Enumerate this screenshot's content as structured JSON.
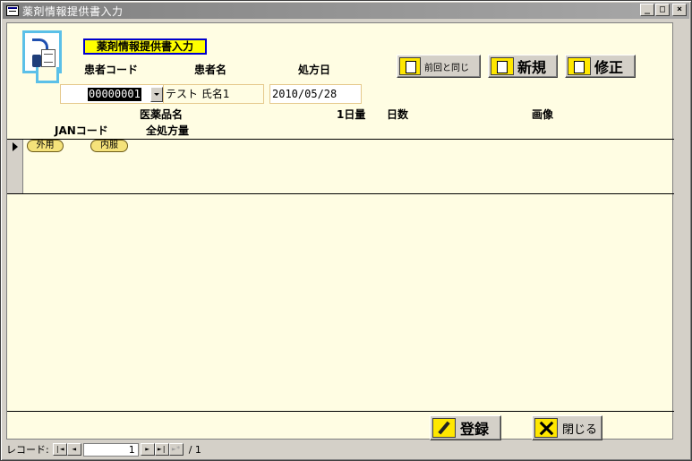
{
  "window": {
    "title": "薬剤情報提供書入力",
    "buttons": {
      "minimize": "_",
      "maximize": "□",
      "close": "×"
    }
  },
  "header": {
    "form_title": "薬剤情報提供書入力",
    "labels": {
      "patient_code": "患者コード",
      "patient_name": "患者名",
      "rx_date": "処方日"
    },
    "fields": {
      "patient_code": "00000001",
      "patient_name": "テスト 氏名1",
      "rx_date": "2010/05/28"
    },
    "buttons": {
      "prev_same": "前回と同じ",
      "new": "新規",
      "edit": "修正"
    }
  },
  "columns": {
    "drug_name": "医薬品名",
    "daily_dose": "1日量",
    "days": "日数",
    "image": "画像",
    "jan_code": "JANコード",
    "total_dose": "全処方量"
  },
  "detail": {
    "pills": [
      "外用",
      "内服"
    ]
  },
  "footer": {
    "register": "登録",
    "close": "閉じる"
  },
  "navigation": {
    "label": "レコード:",
    "current_record": "1",
    "total": "/ 1",
    "first": "|◄",
    "prev": "◄",
    "next": "►",
    "last": "►|",
    "new": "►*"
  },
  "colors": {
    "form_background": "#fffde3",
    "title_highlight": "#ffff00",
    "title_border": "#0000cc",
    "icon_frame": "#5bc0e8",
    "button_icon": "#ffe700"
  }
}
